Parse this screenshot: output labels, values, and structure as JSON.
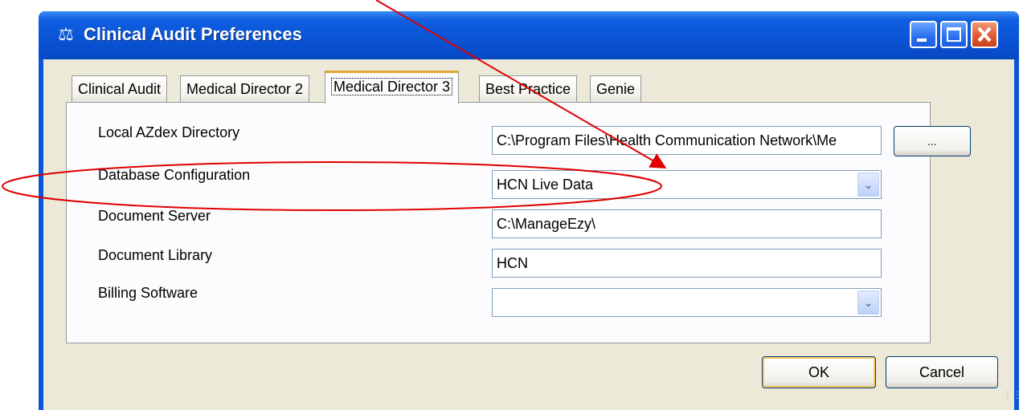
{
  "window": {
    "title": "Clinical Audit Preferences"
  },
  "tabs": [
    {
      "label": "Clinical Audit"
    },
    {
      "label": "Medical Director 2"
    },
    {
      "label": "Medical Director 3"
    },
    {
      "label": "Best Practice"
    },
    {
      "label": "Genie"
    }
  ],
  "active_tab": "Medical Director 3",
  "fields": {
    "azdex": {
      "label": "Local AZdex Directory",
      "value": "C:\\Program Files\\Health Communication Network\\Me"
    },
    "database": {
      "label": "Database Configuration",
      "value": "HCN Live Data"
    },
    "doc_server": {
      "label": "Document Server",
      "value": "C:\\ManageEzy\\"
    },
    "doc_library": {
      "label": "Document Library",
      "value": "HCN"
    },
    "billing": {
      "label": "Billing Software",
      "value": ""
    }
  },
  "buttons": {
    "browse": "...",
    "ok": "OK",
    "cancel": "Cancel"
  },
  "icons": [
    "app-icon",
    "minimize-icon",
    "maximize-icon",
    "close-icon",
    "dropdown-arrow-icon",
    "resize-grip-icon"
  ],
  "annotation_color": "#e00000"
}
